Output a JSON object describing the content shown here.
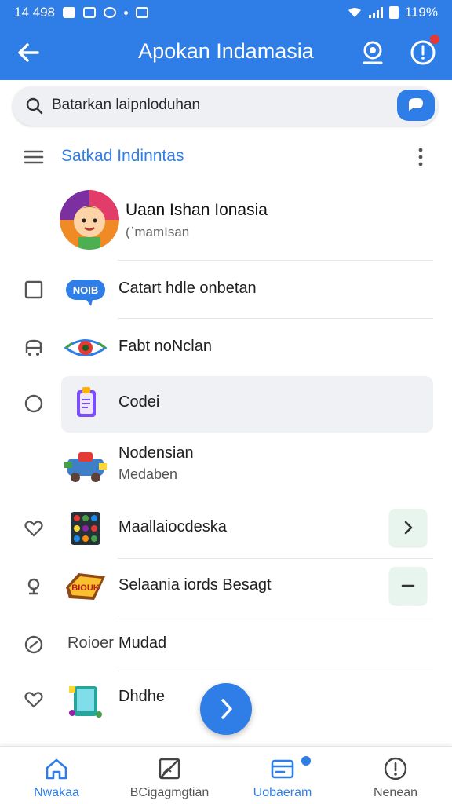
{
  "status_bar": {
    "time": "14 498",
    "battery": "119%"
  },
  "app_bar": {
    "title": "Apokan Indamasia"
  },
  "search": {
    "placeholder": "Batarkan laipnloduhan"
  },
  "section": {
    "title": "Satkad Indinntas"
  },
  "profile": {
    "name": "Uaan Ishan Ionasia",
    "subtitle": "(ˈmamIsan"
  },
  "list": [
    {
      "label": "Catart hdle onbetan"
    },
    {
      "label": "Fabt noNclan"
    },
    {
      "label": "Codei"
    },
    {
      "label": "Nodensian",
      "subtitle": "Medaben"
    },
    {
      "label": "Maallaiocdeska"
    },
    {
      "label": "Selaania iords Besagt"
    },
    {
      "prefix": "Roioer",
      "label": "Mudad"
    },
    {
      "label": "Dhdhe"
    }
  ],
  "bottom_nav": [
    {
      "label": "Nwakaa"
    },
    {
      "label": "BCigagmgtian"
    },
    {
      "label": "Uobaeram"
    },
    {
      "label": "Nenean"
    }
  ],
  "colors": {
    "primary": "#2f7de6",
    "badge_red": "#e53935",
    "trail_bg": "#e7f5ee"
  },
  "icons": {
    "back": "arrow-left-icon",
    "camera": "camera-target-icon",
    "alert": "alert-circle-icon",
    "search": "search-icon",
    "chat": "chat-bubble-icon",
    "menu": "hamburger-icon",
    "more": "kebab-icon",
    "fab": "chevron-right-icon"
  }
}
